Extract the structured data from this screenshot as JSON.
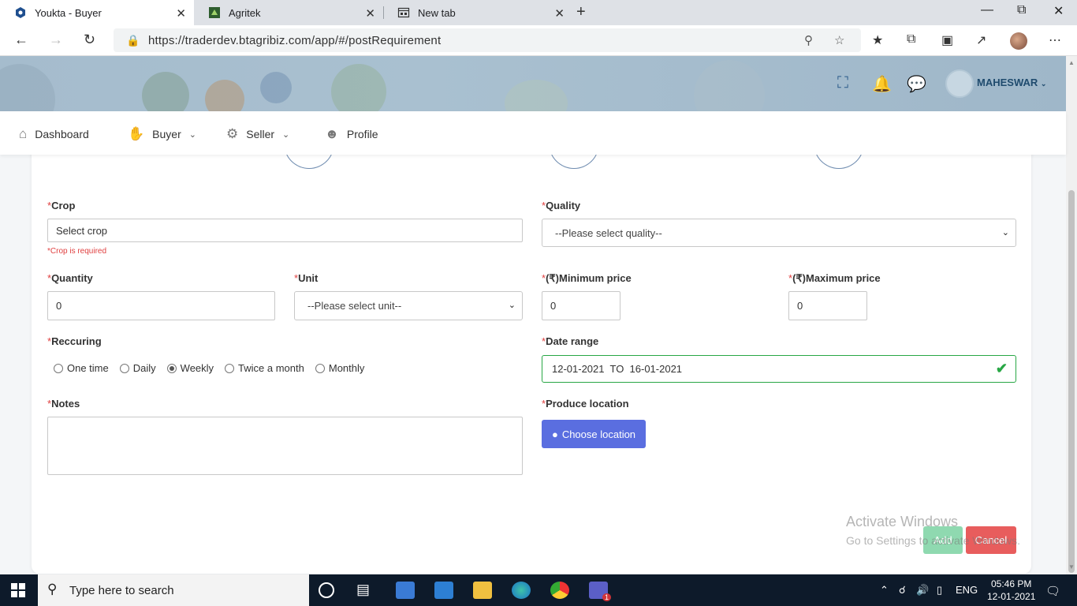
{
  "browser": {
    "tabs": [
      {
        "title": "Youkta - Buyer",
        "icon": "youkta-icon",
        "close": "✕"
      },
      {
        "title": "Agritek",
        "icon": "agritek-icon",
        "close": "✕"
      },
      {
        "title": "New tab",
        "icon": "newtab-page-icon",
        "close": "✕"
      }
    ],
    "url": "https://traderdev.btagribiz.com/app/#/postRequirement"
  },
  "header": {
    "user_name": "MAHESWAR"
  },
  "nav": {
    "items": [
      {
        "label": "Dashboard",
        "icon": "home-icon"
      },
      {
        "label": "Buyer",
        "icon": "buyer-icon"
      },
      {
        "label": "Seller",
        "icon": "seller-icon"
      },
      {
        "label": "Profile",
        "icon": "profile-icon"
      }
    ]
  },
  "form": {
    "required_mark": "*",
    "crop": {
      "label": "Crop",
      "value": "Select crop",
      "error": "*Crop is required"
    },
    "quality": {
      "label": "Quality",
      "value": "--Please select quality--"
    },
    "quantity": {
      "label": "Quantity",
      "value": "0"
    },
    "unit": {
      "label": "Unit",
      "value": "--Please select unit--"
    },
    "min_price": {
      "label": "(₹)Minimum price",
      "value": "0"
    },
    "max_price": {
      "label": "(₹)Maximum price",
      "value": "0"
    },
    "recurring": {
      "label": "Reccuring",
      "options": [
        "One time",
        "Daily",
        "Weekly",
        "Twice a month",
        "Monthly"
      ],
      "selected": "Weekly"
    },
    "date_range": {
      "label": "Date range",
      "value": "12-01-2021  TO  16-01-2021"
    },
    "notes": {
      "label": "Notes",
      "value": ""
    },
    "produce_location": {
      "label": "Produce location",
      "button": "Choose location"
    },
    "add_button": "Add",
    "cancel_button": "Cancel"
  },
  "watermark": {
    "title": "Activate Windows",
    "subtitle": "Go to Settings to activate Windows."
  },
  "taskbar": {
    "search_placeholder": "Type here to search",
    "language": "ENG",
    "time": "05:46 PM",
    "date": "12-01-2021",
    "teams_badge": "1"
  },
  "colors": {
    "primary_button": "#5a6ee0",
    "success": "#28a745",
    "danger": "#e85d5d",
    "add_button": "#8fd9b0",
    "required": "#e04040"
  }
}
